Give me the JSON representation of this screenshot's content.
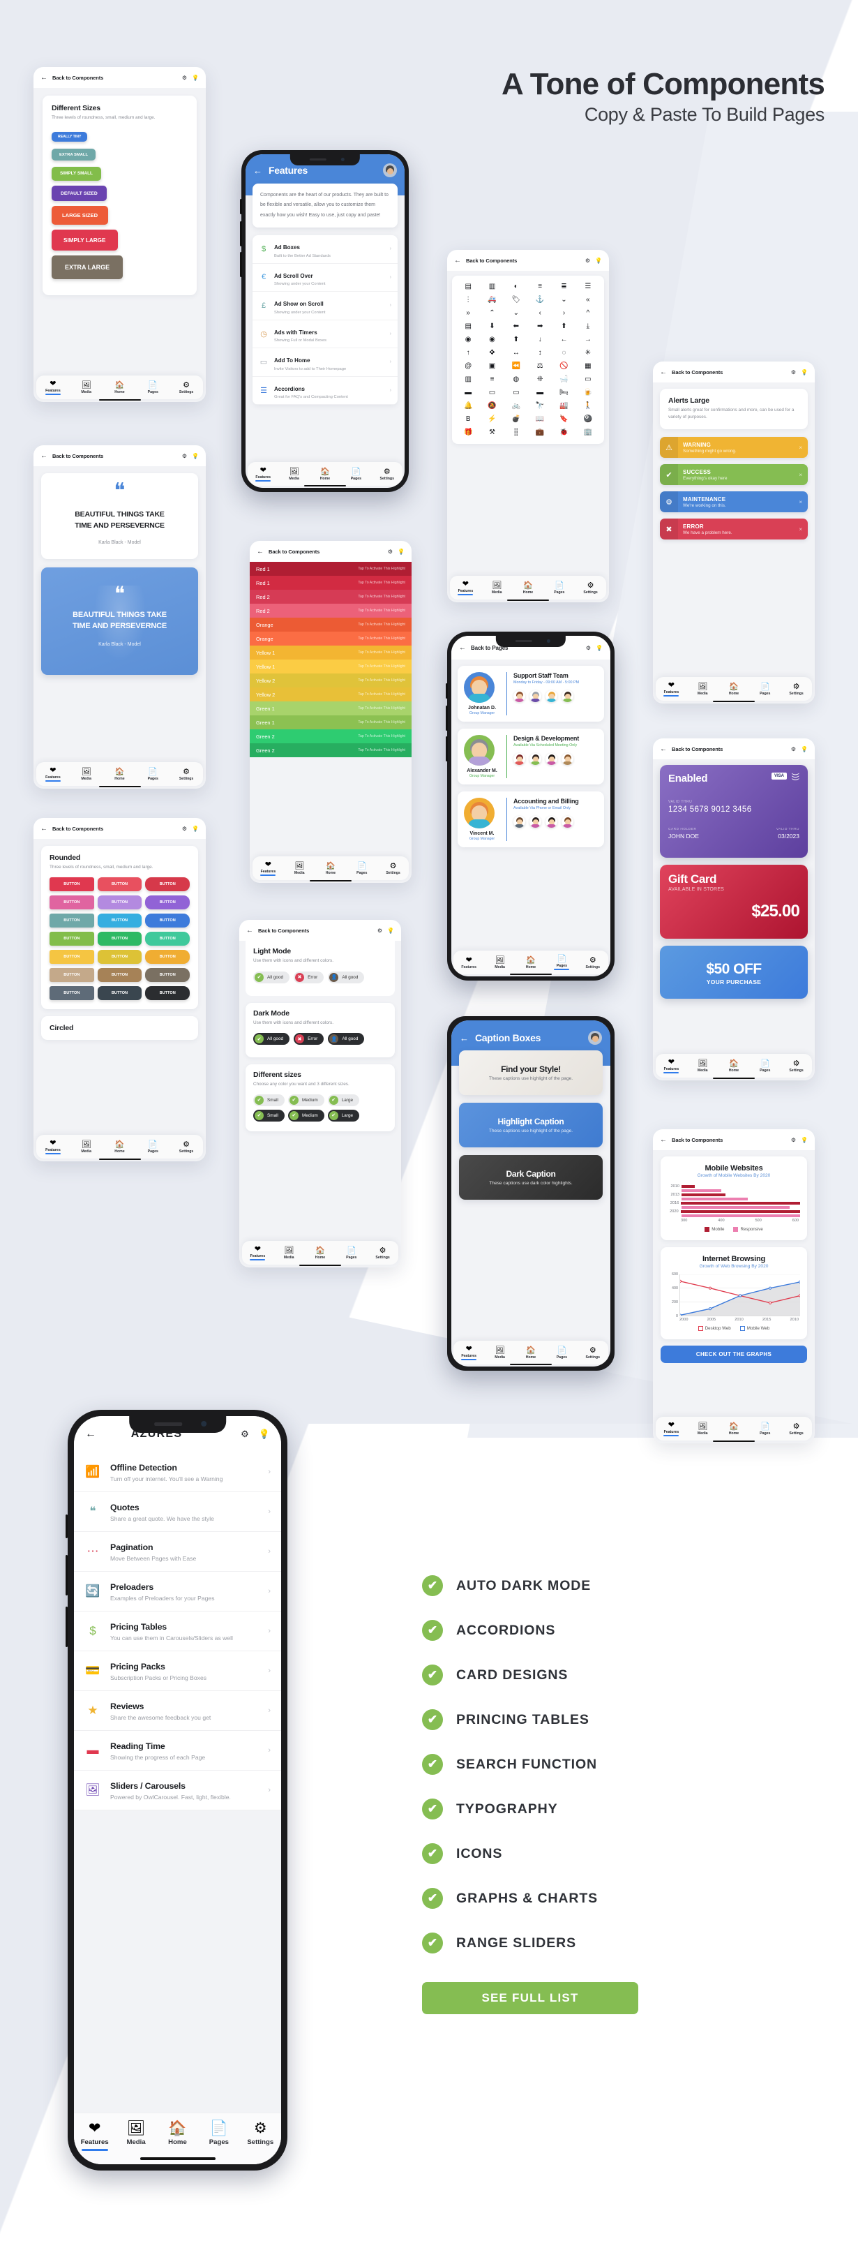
{
  "header": {
    "title": "A Tone of Components",
    "subtitle": "Copy & Paste To Build Pages"
  },
  "common": {
    "back_to_components": "Back to Components",
    "back_to_pages": "Back to Pages",
    "gear_icon": "⚙",
    "bulb_icon": "💡",
    "back_arrow_icon": "←",
    "chevron_right_icon": "›",
    "nav": [
      {
        "label": "Features",
        "icon": "❤"
      },
      {
        "label": "Media",
        "icon": "🖼"
      },
      {
        "label": "Home",
        "icon": "🏠"
      },
      {
        "label": "Pages",
        "icon": "📄"
      },
      {
        "label": "Settings",
        "icon": "⚙"
      }
    ]
  },
  "sizes_card": {
    "title": "Different Sizes",
    "desc": "Three levels of roundness, small, medium and large.",
    "buttons": [
      {
        "label": "REALLY TINY",
        "color": "#3d7bdb",
        "fs": 5.2,
        "px": 9,
        "py": 4
      },
      {
        "label": "EXTRA SMALL",
        "color": "#6fa8a8",
        "fs": 5.8,
        "px": 11,
        "py": 5.5
      },
      {
        "label": "SIMPLY SMALL",
        "color": "#82bd4a",
        "fs": 6.4,
        "px": 12,
        "py": 6.5
      },
      {
        "label": "DEFAULT SIZED",
        "color": "#6a43b0",
        "fs": 6.8,
        "px": 13,
        "py": 7.5
      },
      {
        "label": "LARGE SIZED",
        "color": "#ed5b38",
        "fs": 7.6,
        "px": 15,
        "py": 9
      },
      {
        "label": "SIMPLY LARGE",
        "color": "#e0384f",
        "fs": 8.2,
        "px": 17,
        "py": 10.5
      },
      {
        "label": "EXTRA LARGE",
        "color": "#7a7062",
        "fs": 9,
        "px": 19,
        "py": 12
      }
    ]
  },
  "features_phone": {
    "title": "Features",
    "intro": "Components are the heart of our products. They are built to be flexible and versatile, allow you to customize them exactly how you wish! Easy to use, just copy and paste!",
    "rows": [
      {
        "icon": "$",
        "color": "#4caf50",
        "title": "Ad Boxes",
        "desc": "Built to the Better Ad Standards"
      },
      {
        "icon": "€",
        "color": "#4a9fe0",
        "title": "Ad Scroll Over",
        "desc": "Showing under your Content"
      },
      {
        "icon": "£",
        "color": "#6fa8a8",
        "title": "Ad Show on Scroll",
        "desc": "Showing under your Content"
      },
      {
        "icon": "◷",
        "color": "#d4954a",
        "title": "Ads with Timers",
        "desc": "Showing Full or Modal Boxes"
      },
      {
        "icon": "▭",
        "color": "#9aa0a8",
        "title": "Add To Home",
        "desc": "Invite Visitors to add to Their Homepage"
      },
      {
        "icon": "☰",
        "color": "#3d7bdb",
        "title": "Accordions",
        "desc": "Great for FAQ's and Compacting Content"
      }
    ]
  },
  "quote_card": {
    "quote_mark": "❝",
    "text_line1": "BEAUTIFUL THINGS TAKE",
    "text_line2": "TIME AND PERSEVERNCE",
    "author": "Karla Black - Model"
  },
  "rounded_card": {
    "title": "Rounded",
    "desc": "Three levels of roundness, small, medium and large.",
    "button_label": "BUTTON",
    "second_title": "Circled",
    "colors": [
      [
        "#e0384f",
        "#e8505f",
        "#d6394a"
      ],
      [
        "#e064a0",
        "#b38ae0",
        "#9163d6"
      ],
      [
        "#6fa8a8",
        "#35aee0",
        "#3d7bdb"
      ],
      [
        "#82bd4a",
        "#2eb964",
        "#3fc99b"
      ],
      [
        "#f5c542",
        "#ddc236",
        "#f0ad32"
      ],
      [
        "#c4a98a",
        "#a68257",
        "#7a7062"
      ],
      [
        "#5e6b78",
        "#3a464f",
        "#2b2d30"
      ]
    ]
  },
  "colors_card": {
    "rows": [
      {
        "label": "Red 1",
        "desc": "Tap To Activate This Highlight",
        "color": "#b01e33"
      },
      {
        "label": "Red 1",
        "desc": "Tap To Activate This Highlight",
        "color": "#d22b42"
      },
      {
        "label": "Red 2",
        "desc": "Tap To Activate This Highlight",
        "color": "#d63b55"
      },
      {
        "label": "Red 2",
        "desc": "Tap To Activate This Highlight",
        "color": "#ec6179"
      },
      {
        "label": "Orange",
        "desc": "Tap To Activate This Highlight",
        "color": "#ec5b34"
      },
      {
        "label": "Orange",
        "desc": "Tap To Activate This Highlight",
        "color": "#fb6d44"
      },
      {
        "label": "Yellow 1",
        "desc": "Tap To Activate This Highlight",
        "color": "#f3b532"
      },
      {
        "label": "Yellow 1",
        "desc": "Tap To Activate This Highlight",
        "color": "#fbcc44"
      },
      {
        "label": "Yellow 2",
        "desc": "Tap To Activate This Highlight",
        "color": "#e0c33a"
      },
      {
        "label": "Yellow 2",
        "desc": "Tap To Activate This Highlight",
        "color": "#e8c038"
      },
      {
        "label": "Green 1",
        "desc": "Tap To Activate This Highlight",
        "color": "#a8d36b"
      },
      {
        "label": "Green 1",
        "desc": "Tap To Activate This Highlight",
        "color": "#8cc152"
      },
      {
        "label": "Green 2",
        "desc": "Tap To Activate This Highlight",
        "color": "#2ecc71"
      },
      {
        "label": "Green 2",
        "desc": "Tap To Activate This Highlight",
        "color": "#27ae60"
      }
    ]
  },
  "icons_card": {
    "glyphs": [
      "▤",
      "▥",
      "◐",
      "≡",
      "≣",
      "☰",
      "⋮",
      "🚑",
      "🏷",
      "⚓",
      "⌄",
      "«",
      "»",
      "⌃",
      "⌄",
      "‹",
      "›",
      "^",
      "▤",
      "⬇",
      "⬅",
      "➡",
      "⬆",
      "⤓",
      "◉",
      "◉",
      "⬆",
      "↓",
      "←",
      "→",
      "↑",
      "✥",
      "↔",
      "↕",
      "◌",
      "✳",
      "@",
      "▣",
      "⏪",
      "⚖",
      "🚫",
      "▦",
      "▥",
      "≡",
      "◍",
      "❊",
      "🛁",
      "▭",
      "▬",
      "▭",
      "▭",
      "▬",
      "🛏",
      "🍺",
      "🔔",
      "🔕",
      "🚲",
      "🔭",
      "🏭",
      "🚶",
      "B",
      "⚡",
      "💣",
      "📖",
      "🔖",
      "🎱",
      "🎁",
      "⚒",
      "⣿",
      "💼",
      "🐞",
      "🏢"
    ]
  },
  "alerts_card": {
    "title": "Alerts Large",
    "desc": "Small alerts great for confirmations and more, can be used for a variety of purposes.",
    "alerts": [
      {
        "icon": "⚠",
        "title": "WARNING",
        "desc": "Something might go wrong.",
        "color": "#f0b433"
      },
      {
        "icon": "✔",
        "title": "SUCCESS",
        "desc": "Everything's okay here",
        "color": "#85bd52"
      },
      {
        "icon": "⚙",
        "title": "MAINTENANCE",
        "desc": "We're working on this.",
        "color": "#4a86d8"
      },
      {
        "icon": "✖",
        "title": "ERROR",
        "desc": "We have a problem here.",
        "color": "#d94055"
      }
    ],
    "close_icon": "×"
  },
  "cards_card": {
    "card1": {
      "title": "Enabled",
      "brand": "VISA",
      "nfc_icon": "᯿",
      "valid_thru_label": "VALID THRU",
      "number": "1234 5678 9012 3456",
      "holder_label": "CARD HOLDER",
      "holder": "JOHN DOE",
      "expiry_label": "VALID THRU",
      "expiry": "03/2023"
    },
    "card2": {
      "title": "Gift Card",
      "sub": "AVAILABLE IN STORES",
      "amount": "$25.00"
    },
    "card3": {
      "title": "$50 OFF",
      "sub": "YOUR PURCHASE"
    }
  },
  "team_phone": {
    "groups": [
      {
        "name": "Johnatan D.",
        "role": "Group Manager",
        "title": "Support Staff Team",
        "sub": "Monday to Friday - 09:00 AM - 5:00 PM",
        "accent": "#4a86d8",
        "avatar_bg": "#4a86d8",
        "hair": "#e8863a",
        "body": "#36b4d4",
        "members": [
          {
            "hair": "#8b4f2e",
            "body": "#c85aa5"
          },
          {
            "hair": "#9aa0a8",
            "body": "#6a4ba8"
          },
          {
            "hair": "#e8a63a",
            "body": "#36b4d4"
          },
          {
            "hair": "#3a2a1f",
            "body": "#85bd52"
          }
        ]
      },
      {
        "name": "Alexander M.",
        "role": "Group Manager",
        "title": "Design & Development",
        "sub": "Available Via Scheduled Meeting Only",
        "accent": "#4caf50",
        "avatar_bg": "#85bd52",
        "hair": "#8a8d94",
        "body": "#b3a0d8",
        "members": [
          {
            "hair": "#7a2a2a",
            "body": "#e05a5a"
          },
          {
            "hair": "#2f2320",
            "body": "#85bd52"
          },
          {
            "hair": "#1f1a18",
            "body": "#c85aa5"
          },
          {
            "hair": "#8a5a32",
            "body": "#b08a5a"
          }
        ]
      },
      {
        "name": "Vincent M.",
        "role": "Group Manager",
        "title": "Accounting and Billing",
        "sub": "Available Via Phone or Email Only",
        "accent": "#4a86d8",
        "avatar_bg": "#f0ad32",
        "hair": "#e8863a",
        "body": "#36b4d4",
        "members": [
          {
            "hair": "#6a4a32",
            "body": "#5e6b78"
          },
          {
            "hair": "#2a2220",
            "body": "#c85aa5"
          },
          {
            "hair": "#1f1a18",
            "body": "#c85aa5"
          },
          {
            "hair": "#7a4a2a",
            "body": "#c85aa5"
          }
        ]
      }
    ]
  },
  "caption_phone": {
    "title": "Caption Boxes",
    "boxes": [
      {
        "title": "Find your Style!",
        "desc": "These captions use highlight of the page.",
        "mode": "light"
      },
      {
        "title": "Highlight Caption",
        "desc": "These captions use highlight of the page.",
        "mode": "blue"
      },
      {
        "title": "Dark Caption",
        "desc": "These captions use dark color highlights.",
        "mode": "dark"
      }
    ]
  },
  "modes_card": {
    "light": {
      "title": "Light Mode",
      "desc": "Use them with icons and different colors.",
      "pills": [
        {
          "label": "All good",
          "icon": "✔",
          "circle": "#85bd52",
          "bg": "#e9eaec",
          "fg": "#333"
        },
        {
          "label": "Error",
          "icon": "✖",
          "circle": "#d94055",
          "bg": "#e9eaec",
          "fg": "#333"
        },
        {
          "label": "All good",
          "icon": "👤",
          "circle": "#6a5a4a",
          "bg": "#e9eaec",
          "fg": "#333"
        }
      ]
    },
    "dark": {
      "title": "Dark Mode",
      "desc": "Use them with icons and different colors.",
      "pills": [
        {
          "label": "All good",
          "icon": "✔",
          "circle": "#85bd52",
          "bg": "#2b2d30",
          "fg": "#fff"
        },
        {
          "label": "Error",
          "icon": "✖",
          "circle": "#d94055",
          "bg": "#2b2d30",
          "fg": "#fff"
        },
        {
          "label": "All good",
          "icon": "👤",
          "circle": "#6a5a4a",
          "bg": "#2b2d30",
          "fg": "#fff"
        }
      ]
    },
    "sizes": {
      "title": "Different sizes",
      "desc": "Choose any color you want and 3 different sizes.",
      "light_pills": [
        "Small",
        "Medium",
        "Large"
      ],
      "dark_pills": [
        "Small",
        "Medium",
        "Large"
      ]
    }
  },
  "charts_phone": {
    "cta": "CHECK OUT THE GRAPHS"
  },
  "chart_data": [
    {
      "type": "bar",
      "title": "Mobile Websites",
      "subtitle": "Growth of Mobile Websites By 2020",
      "orientation": "horizontal",
      "categories": [
        "2010",
        "2013",
        "2016",
        "2020"
      ],
      "series": [
        {
          "name": "Mobile",
          "color": "#b01e33",
          "values": [
            330,
            400,
            580,
            595
          ]
        },
        {
          "name": "Responsive",
          "color": "#ec7fb0",
          "values": [
            390,
            450,
            545,
            570
          ]
        }
      ],
      "xlim": [
        300,
        600
      ],
      "xticks": [
        300,
        400,
        500,
        600
      ],
      "grid": true,
      "legend": "bottom"
    },
    {
      "type": "line",
      "title": "Internet Browsing",
      "subtitle": "Growth of Web Browsing By 2020",
      "x": [
        "2000",
        "2005",
        "2010",
        "2015",
        "2010"
      ],
      "series": [
        {
          "name": "Desktop Web",
          "color": "#e03c4e",
          "values": [
            500,
            400,
            290,
            185,
            290
          ]
        },
        {
          "name": "Mobile Web",
          "color": "#3d7bdb",
          "values": [
            5,
            100,
            290,
            400,
            490
          ]
        }
      ],
      "ylim": [
        0,
        600
      ],
      "yticks": [
        0,
        200,
        400,
        600
      ],
      "grid": true,
      "legend": "bottom"
    }
  ],
  "hero_phone": {
    "title": "AZURES",
    "rows": [
      {
        "icon": "📶",
        "color": "#85bd52",
        "title": "Offline Detection",
        "desc": "Turn off your internet. You'll see a Warning"
      },
      {
        "icon": "❝",
        "color": "#6fa8a8",
        "title": "Quotes",
        "desc": "Share a great quote. We have the style"
      },
      {
        "icon": "⋯",
        "color": "#d94055",
        "title": "Pagination",
        "desc": "Move Between Pages with Ease"
      },
      {
        "icon": "🔄",
        "color": "#ed5b38",
        "title": "Preloaders",
        "desc": "Examples of Preloaders for your Pages"
      },
      {
        "icon": "$",
        "color": "#85bd52",
        "title": "Pricing Tables",
        "desc": "You can use them in Carousels/Sliders as well"
      },
      {
        "icon": "💳",
        "color": "#2eb964",
        "title": "Pricing Packs",
        "desc": "Subscription Packs or Pricing Boxes"
      },
      {
        "icon": "★",
        "color": "#f0b433",
        "title": "Reviews",
        "desc": "Share the awesome feedback you get"
      },
      {
        "icon": "▬",
        "color": "#e0384f",
        "title": "Reading Time",
        "desc": "Showing the progress of each Page"
      },
      {
        "icon": "🖼",
        "color": "#6a43b0",
        "title": "Sliders / Carousels",
        "desc": "Powered by OwlCarousel. Fast, light, flexible."
      }
    ]
  },
  "checklist": {
    "check_icon": "✔",
    "items": [
      "AUTO DARK MODE",
      "ACCORDIONS",
      "CARD DESIGNS",
      "PRINCING TABLES",
      "SEARCH FUNCTION",
      "TYPOGRAPHY",
      "ICONS",
      "GRAPHS & CHARTS",
      "RANGE SLIDERS"
    ],
    "button_label": "SEE FULL LIST",
    "accent": "#85bd52"
  }
}
